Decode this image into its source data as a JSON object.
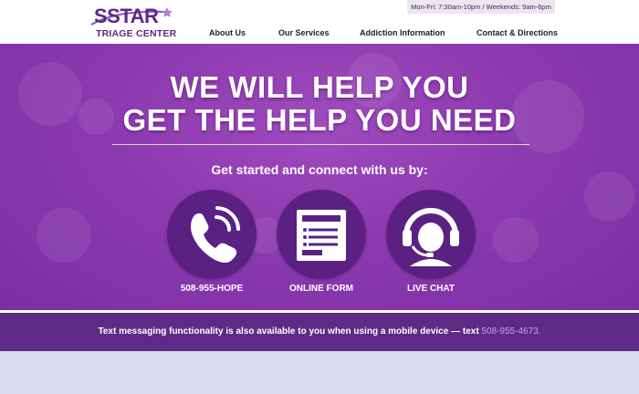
{
  "brand": {
    "name": "SSTAR",
    "tagline": "TRIAGE CENTER"
  },
  "header": {
    "hours": "Mon-Fri: 7:30am-10pm / Weekends: 9am-6pm",
    "nav": [
      "About Us",
      "Our Services",
      "Addiction Information",
      "Contact & Directions"
    ]
  },
  "hero": {
    "headline_line1": "WE WILL HELP YOU",
    "headline_line2": "GET THE HELP YOU NEED",
    "subhead": "Get started and connect with us by:",
    "options": [
      {
        "label": "508-955-HOPE",
        "icon": "phone-icon"
      },
      {
        "label": "ONLINE FORM",
        "icon": "form-icon"
      },
      {
        "label": "LIVE CHAT",
        "icon": "headset-agent-icon"
      }
    ]
  },
  "band": {
    "text": "Text messaging functionality is also available to you when using a mobile device — text ",
    "phone": "508-955-4673."
  },
  "colors": {
    "brand_purple": "#5b2a86",
    "hero_purple": "#8c3aaf",
    "circle_purple": "#5a2182",
    "band_purple": "#5e2a86",
    "link_lavender": "#c9a2ec",
    "footer_lavender": "#dbdcf1"
  }
}
